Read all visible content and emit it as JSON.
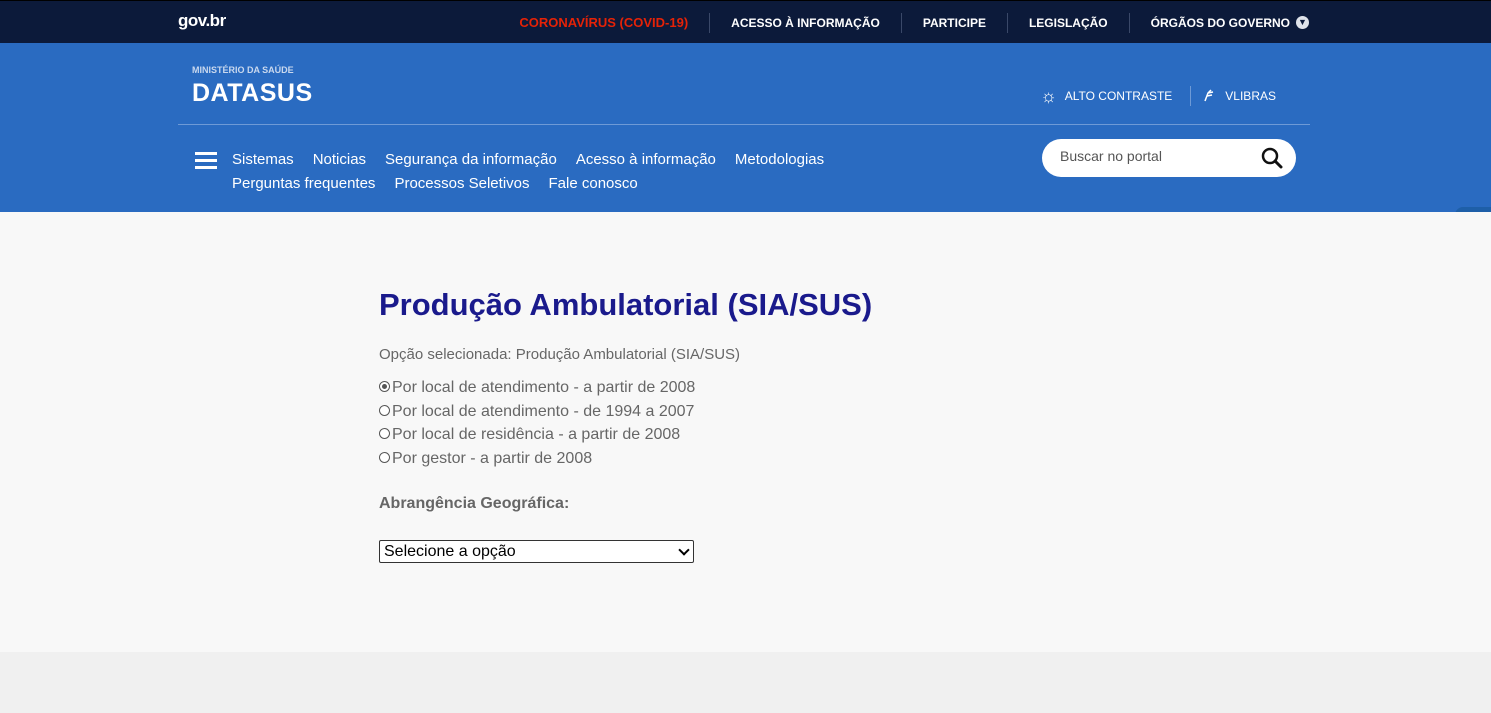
{
  "govbar": {
    "logo": "gov.br",
    "links": [
      "CORONAVÍRUS (COVID-19)",
      "ACESSO À INFORMAÇÃO",
      "PARTICIPE",
      "LEGISLAÇÃO",
      "ÓRGÃOS DO GOVERNO"
    ],
    "covid_color": "#e52207"
  },
  "header": {
    "ministry": "MINISTÉRIO DA SAÚDE",
    "brand": "DATASUS",
    "tools": {
      "contrast": "ALTO CONTRASTE",
      "vlibras": "VLIBRAS"
    },
    "nav": [
      "Sistemas",
      "Noticias",
      "Segurança da informação",
      "Acesso à informação",
      "Metodologias",
      "Perguntas frequentes",
      "Processos Seletivos",
      "Fale conosco"
    ],
    "search_placeholder": "Buscar no portal",
    "background": "#2a6bc1"
  },
  "main": {
    "title": "Produção Ambulatorial (SIA/SUS)",
    "selected_option": "Opção selecionada: Produção Ambulatorial (SIA/SUS)",
    "radios": [
      {
        "label": "Por local de atendimento - a partir de 2008",
        "checked": true
      },
      {
        "label": "Por local de atendimento - de 1994 a 2007",
        "checked": false
      },
      {
        "label": "Por local de residência - a partir de 2008",
        "checked": false
      },
      {
        "label": "Por gestor - a partir de 2008",
        "checked": false
      }
    ],
    "geo_label": "Abrangência Geográfica:",
    "select_value": "Selecione a opção",
    "title_color": "#1a1a8c"
  },
  "icons": [
    "govbr-logo",
    "chevron-down-icon",
    "sun-icon",
    "sign-language-icon",
    "menu-icon",
    "search-icon",
    "vlibras-hand-icon"
  ]
}
